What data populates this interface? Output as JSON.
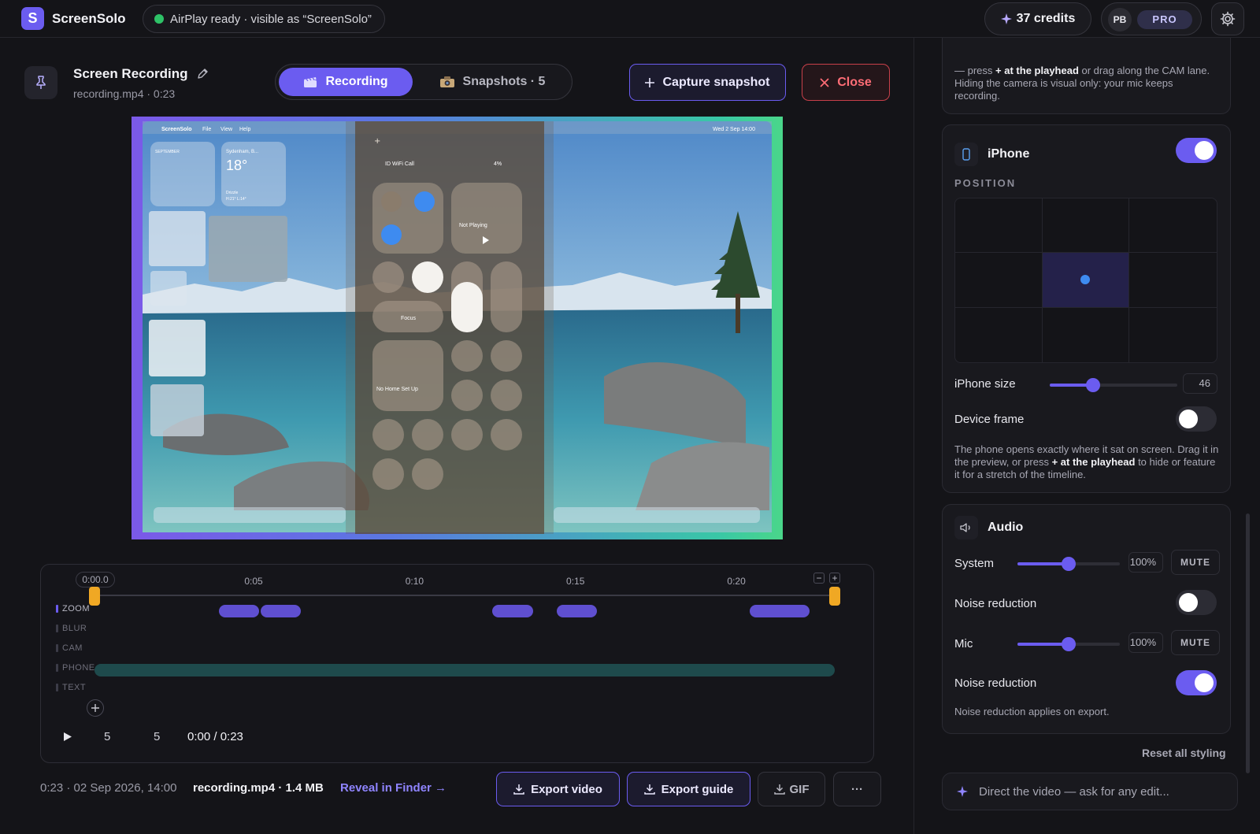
{
  "app": {
    "logo_letter": "S",
    "title": "ScreenSolo"
  },
  "airplay": {
    "status": "AirPlay ready · visible as “ScreenSolo”"
  },
  "account": {
    "credits": "37 credits",
    "initials": "PB",
    "plan": "PRO"
  },
  "recording": {
    "title": "Screen Recording",
    "subtitle": "recording.mp4 · 0:23"
  },
  "tabs": [
    {
      "label": "Recording",
      "active": true
    },
    {
      "label": "Snapshots · 5",
      "active": false
    }
  ],
  "actions": {
    "capture": "Capture snapshot",
    "close": "Close"
  },
  "preview": {
    "menubar_app": "ScreenSolo",
    "menubar_items": [
      "File",
      "View",
      "Help"
    ],
    "clock": "Wed 2 Sep 14:00",
    "weather_city": "Sydenham, B...",
    "weather_temp": "18°",
    "weather_cond": "Drizzle",
    "weather_range": "H:21° L:14°",
    "calendar_month": "SEPTEMBER",
    "cc_status": "ID WiFi Call",
    "cc_battery": "4%",
    "cc_now_playing": "Not Playing",
    "cc_focus": "Focus",
    "cc_home": "No Home Set Up"
  },
  "timeline": {
    "ticks": [
      "0:00.0",
      "0:05",
      "0:10",
      "0:15",
      "0:20"
    ],
    "lanes": [
      "ZOOM",
      "BLUR",
      "CAM",
      "PHONE",
      "TEXT"
    ],
    "zoom_clips": [
      [
        1.2,
        2.5
      ],
      [
        2.5,
        3.8
      ],
      [
        9.7,
        11.0
      ],
      [
        11.7,
        13.0
      ],
      [
        17.7,
        19.6
      ]
    ],
    "phone_clip": [
      0.0,
      23.0
    ],
    "duration": 23,
    "rewind_label": "5",
    "forward_label": "5",
    "time_display": "0:00 / 0:23"
  },
  "footer": {
    "meta": "0:23 · 02 Sep 2026, 14:00",
    "file": "recording.mp4 · 1.4 MB",
    "reveal": "Reveal in Finder →",
    "export_video": "Export video",
    "export_guide": "Export guide",
    "gif": "GIF",
    "more": "···"
  },
  "sidebar": {
    "cam_tip_pre": "— press",
    "cam_tip_bold": "at the playhead",
    "cam_tip_post": "or drag along the CAM lane. Hiding the camera is visual only: your mic keeps recording.",
    "iphone": {
      "title": "iPhone",
      "enabled": true,
      "position_label": "POSITION",
      "position_selected": "center",
      "size_label": "iPhone size",
      "size_value": "46",
      "size_fraction": 0.34,
      "device_frame_label": "Device frame",
      "device_frame_on": false,
      "note_pre": "The phone opens exactly where it sat on screen. Drag it in the preview, or press",
      "note_bold": "at the playhead",
      "note_post": "to hide or feature it for a stretch of the timeline."
    },
    "audio": {
      "title": "Audio",
      "system_label": "System",
      "system_value": "100%",
      "system_fraction": 0.5,
      "mute_label": "MUTE",
      "noise1_label": "Noise reduction",
      "noise1_on": false,
      "mic_label": "Mic",
      "mic_value": "100%",
      "mic_fraction": 0.5,
      "noise2_label": "Noise reduction",
      "noise2_on": true,
      "note": "Noise reduction applies on export."
    },
    "reset": "Reset all styling",
    "prompt_placeholder": "Direct the video — ask for any edit..."
  },
  "colors": {
    "accent": "#6b5cf0",
    "danger": "#ff6d76",
    "ready": "#2ec267",
    "playhead": "#f0a824"
  }
}
